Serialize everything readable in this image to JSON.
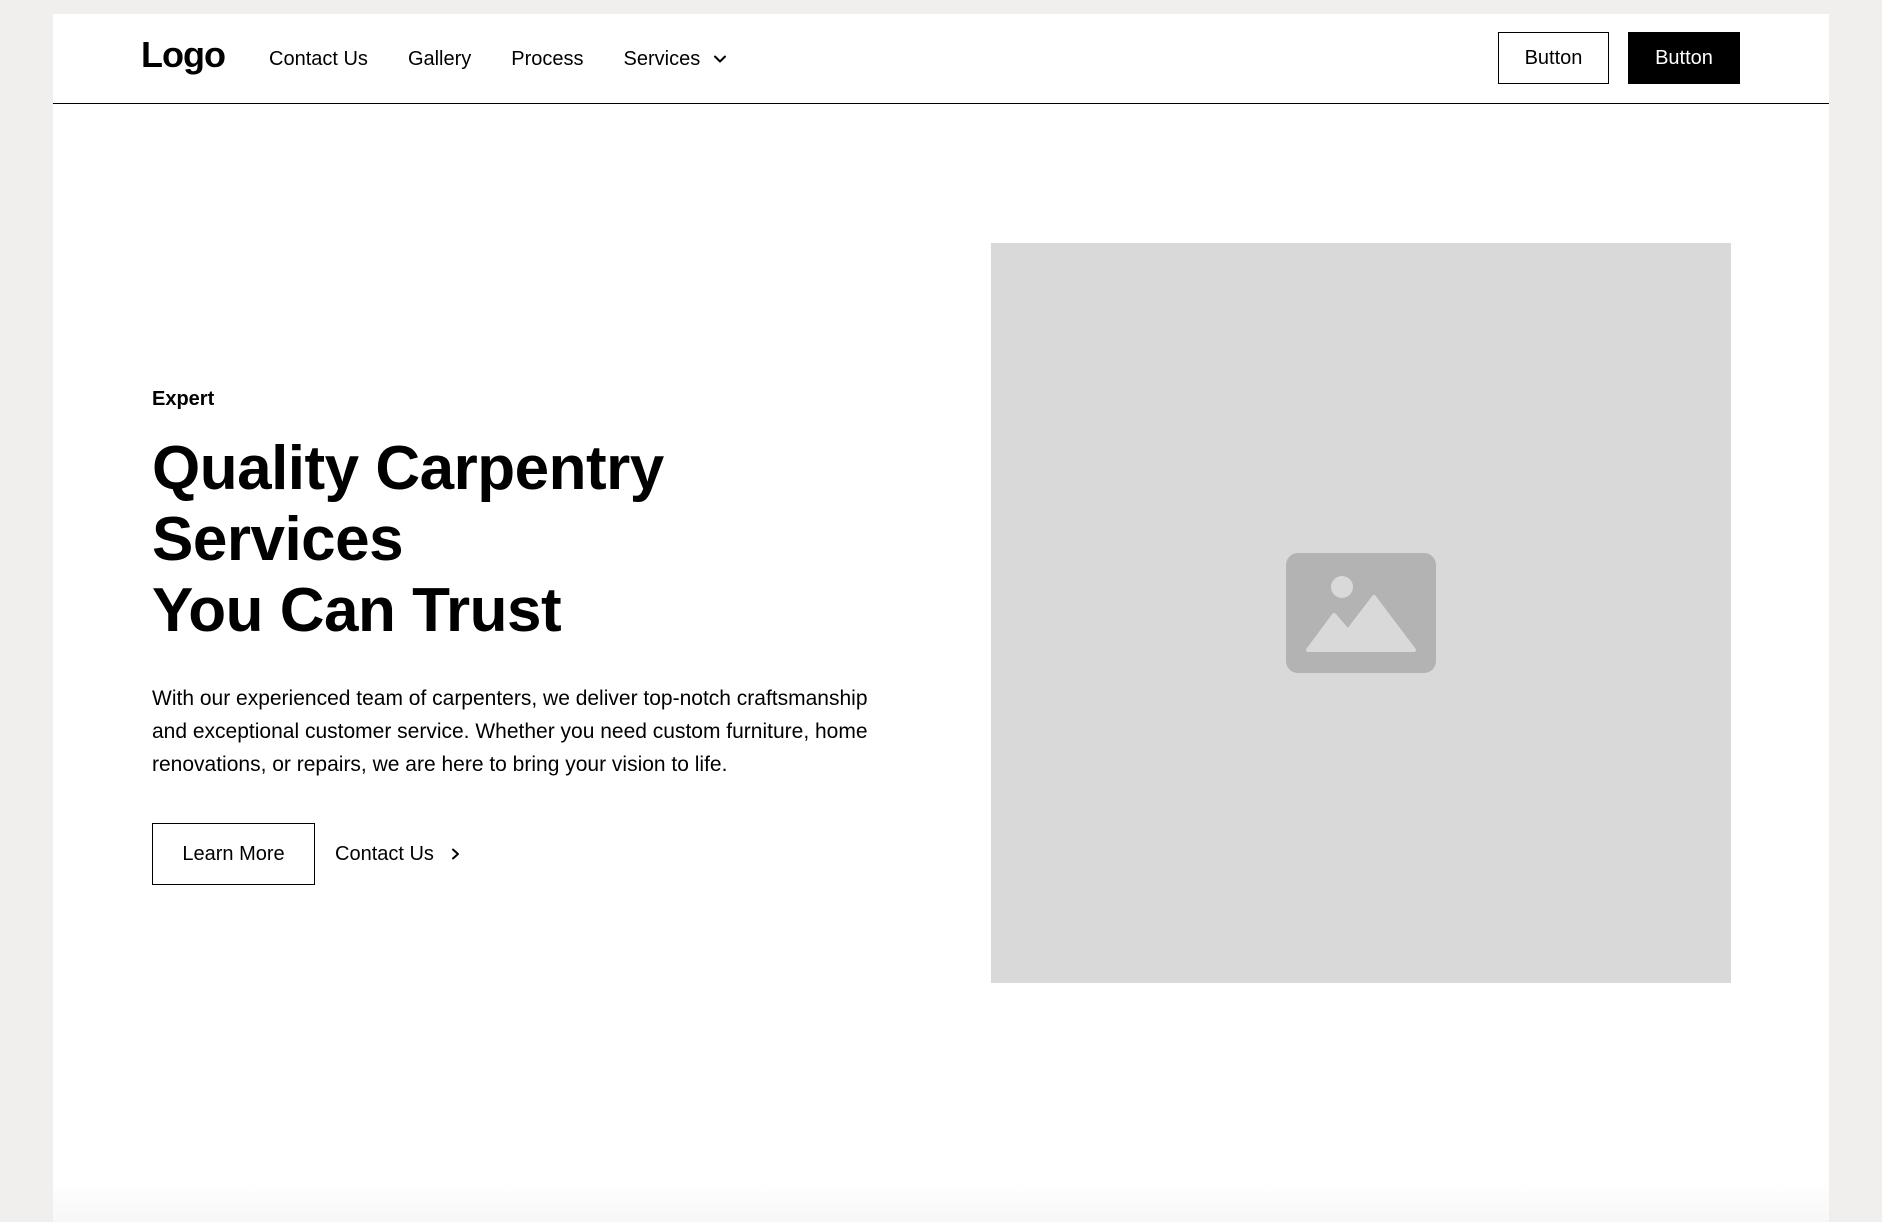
{
  "navbar": {
    "logo": "Logo",
    "links": {
      "contact": "Contact Us",
      "gallery": "Gallery",
      "process": "Process",
      "services": "Services"
    },
    "buttons": {
      "secondary": "Button",
      "primary": "Button"
    }
  },
  "hero": {
    "tagline": "Expert",
    "headline_line1": "Quality Carpentry Services",
    "headline_line2": "You Can Trust",
    "description": "With our experienced team of carpenters, we deliver top-notch craftsmanship and exceptional customer service. Whether you need custom furniture, home renovations, or repairs, we are here to bring your vision to life.",
    "learn_more": "Learn More",
    "contact_link": "Contact Us",
    "image_icon": "image-placeholder-icon"
  },
  "colors": {
    "background": "#f0efed",
    "page": "#ffffff",
    "text": "#000000",
    "placeholder": "#d9d9d9",
    "placeholder_icon": "#b3b3b3"
  }
}
